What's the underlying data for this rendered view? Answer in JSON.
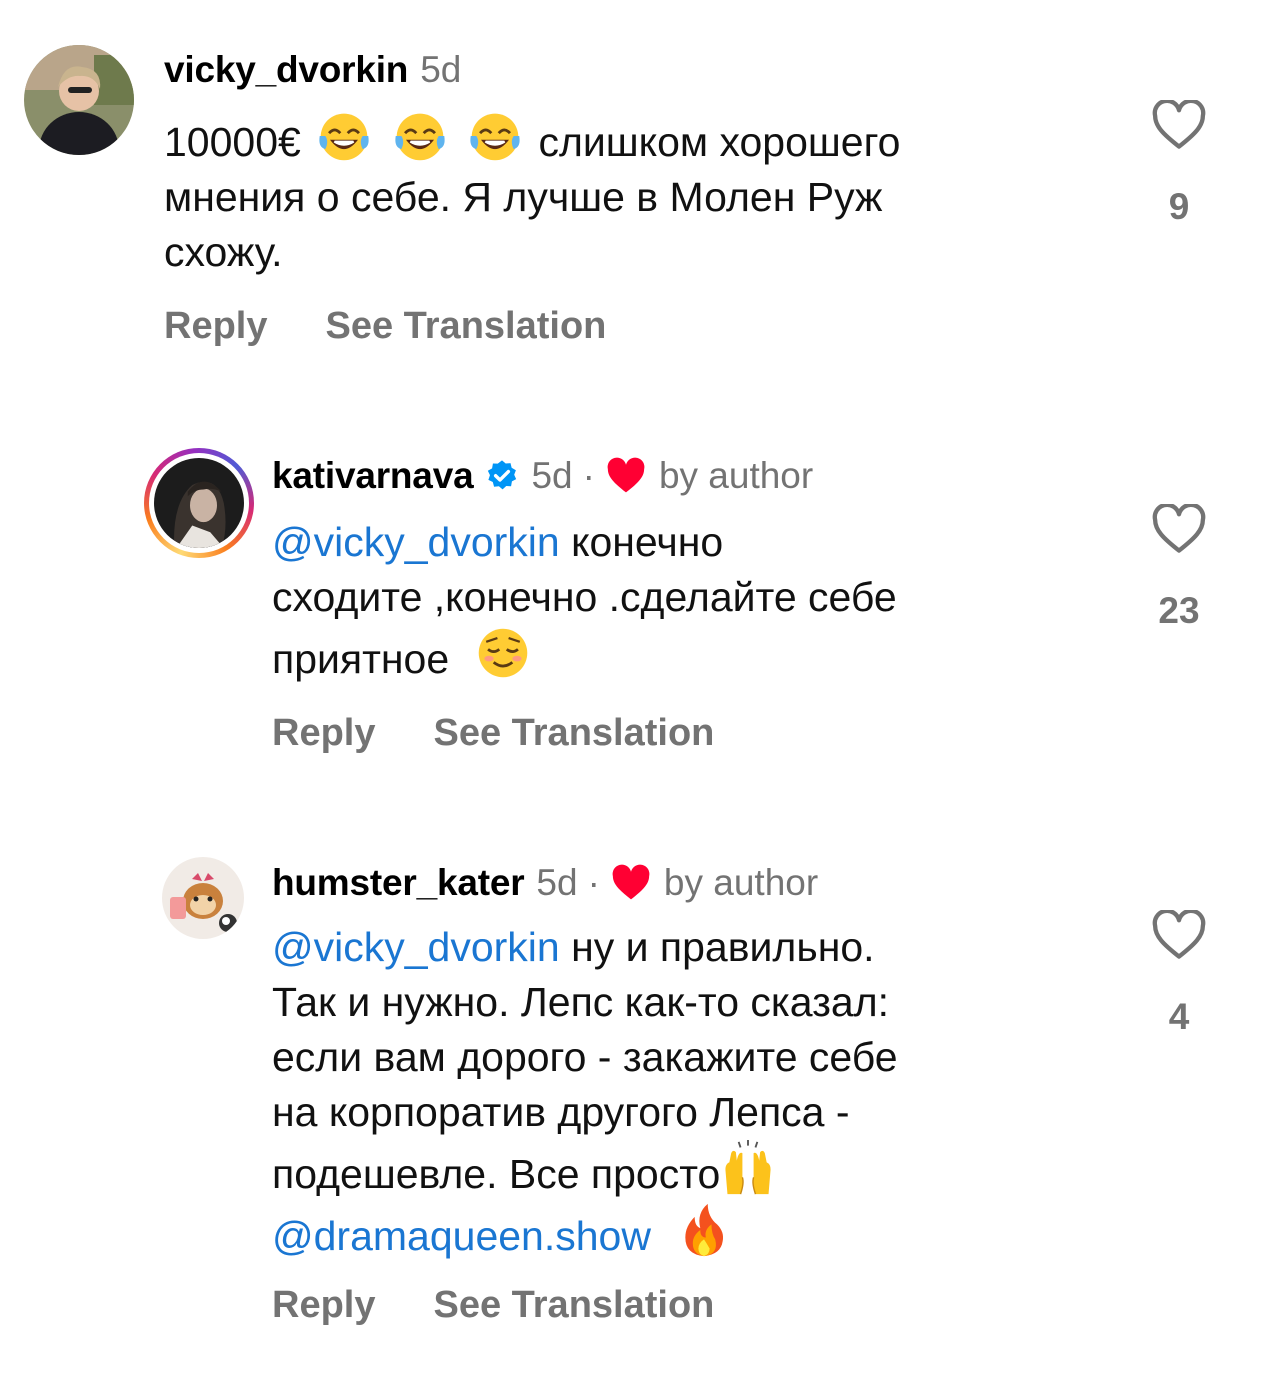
{
  "comments": [
    {
      "username": "vicky_dvorkin",
      "time": "5d",
      "lines": [
        {
          "pre": "10000€",
          "post": "слишком хорошего"
        },
        {
          "text": "мнения о себе. Я лучше в Молен Руж"
        },
        {
          "text": "схожу."
        }
      ],
      "reply": "Reply",
      "translate": "See Translation",
      "likes": "9"
    },
    {
      "username": "kativarnava",
      "time": "5d",
      "liked_by": "by author",
      "lines": [
        {
          "mention": "@vicky_dvorkin",
          "text": " конечно"
        },
        {
          "text": "сходите ,конечно .сделайте себе"
        },
        {
          "text": "приятное"
        }
      ],
      "reply": "Reply",
      "translate": "See Translation",
      "likes": "23"
    },
    {
      "username": "humster_kater",
      "time": "5d",
      "liked_by": "by author",
      "lines": [
        {
          "mention": "@vicky_dvorkin",
          "text": " ну и правильно."
        },
        {
          "text": "Так и нужно. Лепс как-то сказал:"
        },
        {
          "text": "если вам дорого - закажите себе"
        },
        {
          "text": "на корпоратив другого Лепса -"
        },
        {
          "text": "подешевле. Все просто"
        },
        {
          "mention": "@dramaqueen.show"
        }
      ],
      "reply": "Reply",
      "translate": "See Translation",
      "likes": "4"
    }
  ],
  "separator": "·",
  "colors": {
    "mention": "#1a76d2",
    "muted": "#737373",
    "heart": "#ff0033",
    "verified": "#0095f6"
  },
  "icons": {
    "like": "heart-outline-icon",
    "author_like": "heart-filled-icon",
    "verified": "verified-badge-icon"
  }
}
